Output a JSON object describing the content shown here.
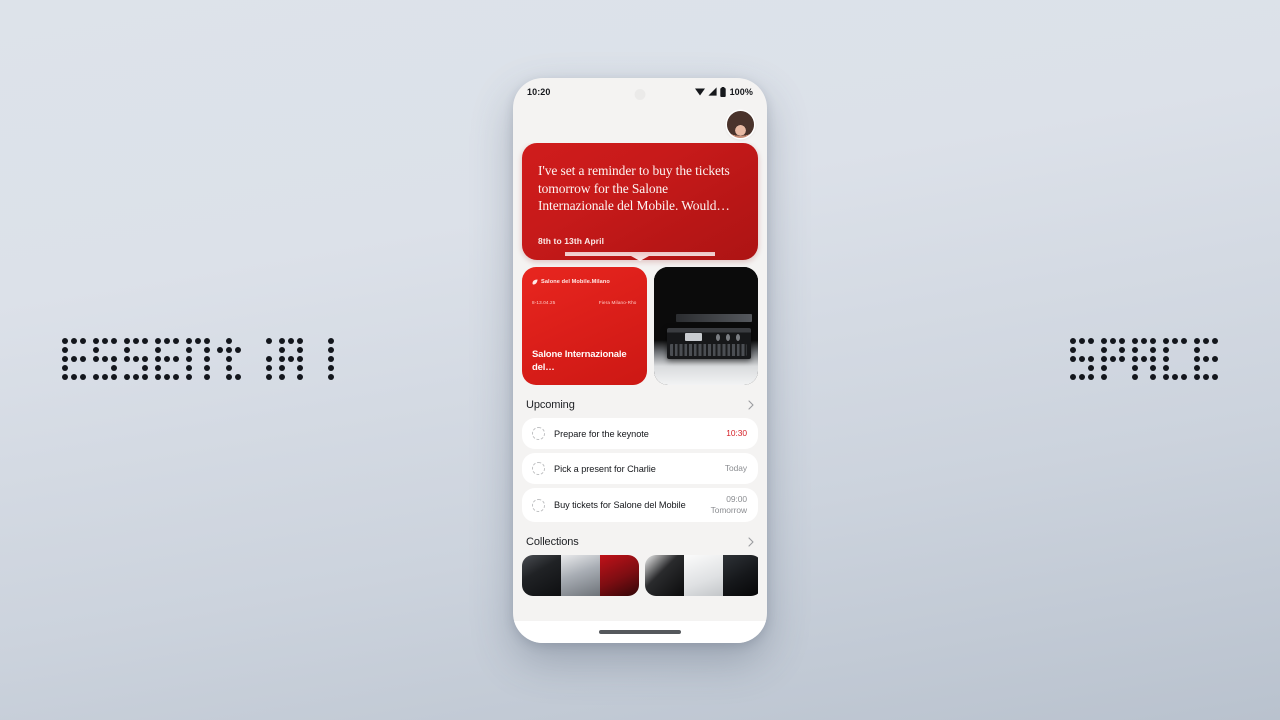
{
  "background": {
    "top_color": "#dde3ea",
    "bottom_color": "#b9c2ce"
  },
  "wordmarks": {
    "left": "essential",
    "right": "space",
    "dot_color": "#13161c"
  },
  "phone": {
    "status_bar": {
      "time": "10:20",
      "battery_percent": "100%",
      "icons": [
        "wifi-icon",
        "cellular-signal-icon",
        "battery-icon"
      ]
    },
    "header": {
      "avatar": "user-avatar"
    },
    "hero_card": {
      "message": "I've set a reminder to buy the tickets tomorrow for the Salone Internazionale del Mobile. Would…",
      "date_range": "8th to 13th April",
      "accent_color": "#c71a1a"
    },
    "tiles": {
      "poster": {
        "brand": "Salone del Mobile.Milano",
        "brand_icon": "leaf-icon",
        "dates": "8-13.04.25",
        "venue": "Fiera Milano-Rho",
        "title": "Salone Internazionale del…"
      },
      "product": {
        "alt": "black synthesizer product photo"
      }
    },
    "upcoming": {
      "title": "Upcoming",
      "chevron": "chevron-right-icon",
      "tasks": [
        {
          "label": "Prepare for the keynote",
          "time": "10:30",
          "sub": "",
          "accent": true
        },
        {
          "label": "Pick a present for Charlie",
          "time": "Today",
          "sub": "",
          "accent": false
        },
        {
          "label": "Buy tickets for Salone del Mobile",
          "time": "09:00",
          "sub": "Tomorrow",
          "accent": false
        }
      ]
    },
    "collections": {
      "title": "Collections",
      "chevron": "chevron-right-icon",
      "groups": [
        {
          "thumbs": [
            "dark-figure-thumb",
            "silver-hood-thumb",
            "red-portrait-thumb"
          ]
        },
        {
          "thumbs": [
            "dark-abstract-thumb",
            "glass-clock-thumb",
            "dark-product-thumb"
          ]
        }
      ]
    },
    "home_indicator": "home-indicator"
  }
}
